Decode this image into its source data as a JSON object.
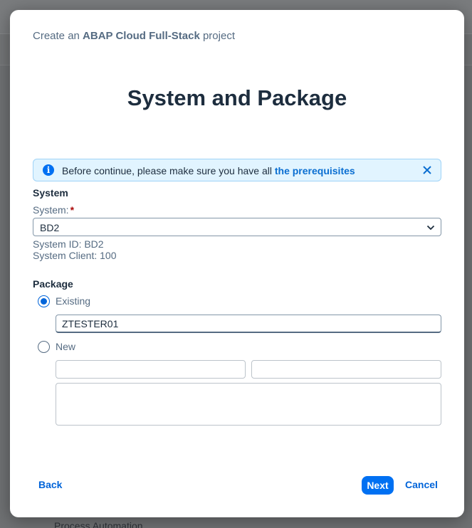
{
  "background": {
    "footer_text": "Process Automation"
  },
  "dialog": {
    "header_prefix": "Create an ",
    "header_bold": "ABAP Cloud Full-Stack",
    "header_suffix": " project",
    "title": "System and Package",
    "info": {
      "icon": "info-icon",
      "text": "Before continue, please make sure you have all ",
      "link": "the prerequisites",
      "close_icon": "close-icon",
      "color": "#e1f4ff"
    },
    "system": {
      "section_title": "System",
      "label": "System:",
      "required_marker": "*",
      "selected": "BD2",
      "system_id": "System ID: BD2",
      "system_client": "System Client: 100"
    },
    "package": {
      "section_title": "Package",
      "existing_label": "Existing",
      "existing_value": "ZTESTER01",
      "existing_checked": true,
      "new_label": "New",
      "new_checked": false,
      "new_name_value": "",
      "new_super_package_value": "",
      "new_description_value": ""
    },
    "footer": {
      "back": "Back",
      "next": "Next",
      "cancel": "Cancel",
      "accent": "#0070f2"
    }
  }
}
